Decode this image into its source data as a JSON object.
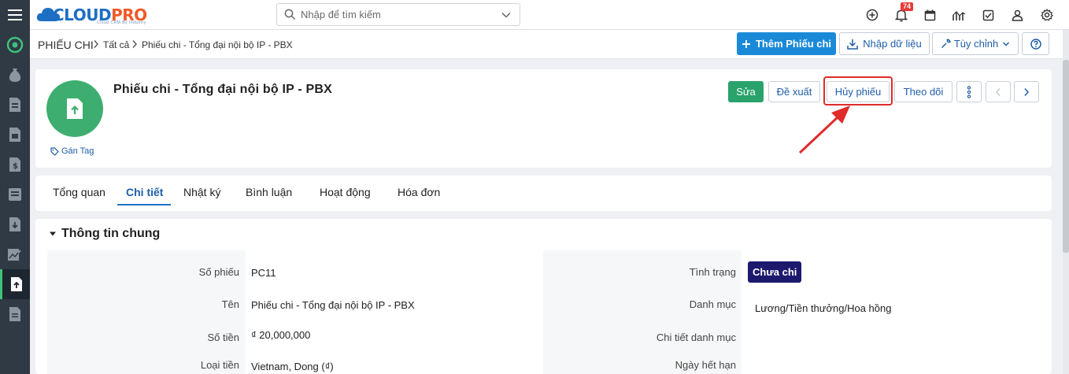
{
  "header": {
    "logo_main_a": "CLOUD",
    "logo_main_b": "PRO",
    "logo_tagline": "Cloud CRM By Industry",
    "search_placeholder": "Nhập để tìm kiếm",
    "notification_count": "74",
    "icons": [
      "add-circle-icon",
      "bell-icon",
      "calendar-icon",
      "chart-icon",
      "checkbox-icon",
      "user-icon",
      "gear-icon"
    ]
  },
  "sidebar": {
    "items": [
      "home-icon",
      "money-bag-icon",
      "document-icon",
      "document-icon",
      "invoice-icon",
      "book-icon",
      "download-doc-icon",
      "chart-doc-icon",
      "upload-doc-icon",
      "file-icon"
    ]
  },
  "breadcrumb": {
    "root": "PHIẾU CHI",
    "level1": "Tất cả",
    "level2": "Phiếu chi - Tổng đại nội bộ IP - PBX"
  },
  "toolbar": {
    "add_label": "Thêm Phiếu chi",
    "import_label": "Nhập dữ liệu",
    "customize_label": "Tùy chỉnh"
  },
  "record": {
    "title": "Phiếu chi - Tổng đại nội bộ IP - PBX",
    "tag_label": "Gán Tag",
    "actions": {
      "edit": "Sửa",
      "propose": "Đề xuất",
      "cancel": "Hủy phiếu",
      "follow": "Theo dõi"
    }
  },
  "tabs": [
    "Tổng quan",
    "Chi tiết",
    "Nhật ký",
    "Bình luận",
    "Hoạt động",
    "Hóa đơn"
  ],
  "active_tab": "Chi tiết",
  "section": {
    "title": "Thông tin chung",
    "left_fields": [
      {
        "label": "Số phiếu",
        "value": "PC11"
      },
      {
        "label": "Tên",
        "value": "Phiếu chi - Tổng đại nội bộ IP - PBX"
      },
      {
        "label": "Số tiền",
        "value": "₫ 20,000,000"
      },
      {
        "label": "Loại tiền",
        "value": "Vietnam, Dong (₫)"
      }
    ],
    "right_fields": [
      {
        "label": "Tình trạng",
        "value": "Chưa chi"
      },
      {
        "label": "Danh mục",
        "value": "Lương/Tiền thưởng/Hoa hồng"
      },
      {
        "label": "Chi tiết danh mục",
        "value": ""
      },
      {
        "label": "Ngày hết hạn",
        "value": ""
      }
    ]
  },
  "colors": {
    "primary": "#1a8ad8",
    "sidebar": "#2f3a45",
    "edit_button": "#2aa26b",
    "status_badge": "#1d1a6e",
    "highlight": "#e02b2b"
  }
}
